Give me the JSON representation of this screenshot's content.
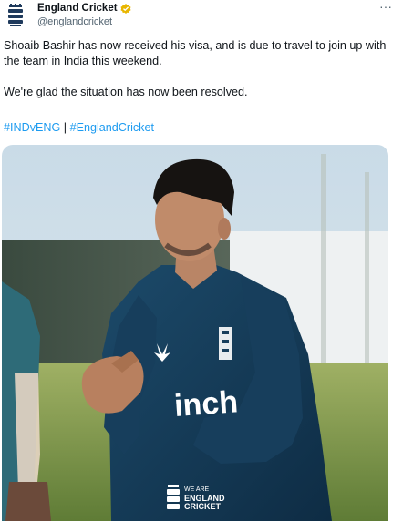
{
  "account": {
    "display_name": "England Cricket",
    "handle": "@englandcricket",
    "avatar_icon": "three-lions-crest-icon",
    "verified_icon": "gold-verified-badge-icon",
    "more_icon": "more-options-icon"
  },
  "tweet": {
    "paragraphs": [
      "Shoaib Bashir has now received his visa, and is due to travel to join up with the team in India this weekend.",
      "We're glad the situation has now been resolved."
    ],
    "hashtags": [
      "#INDvENG",
      "#EnglandCricket"
    ],
    "hashtag_separator": "|"
  },
  "media": {
    "description_icon": "photo-cricketer-icon",
    "watermark_line1": "WE ARE",
    "watermark_line2": "ENGLAND",
    "watermark_line3": "CRICKET"
  },
  "colors": {
    "link": "#1d9bf0",
    "text": "#0f1419",
    "secondary": "#536471",
    "verified": "#e8b600",
    "shirt": "#12344f"
  }
}
